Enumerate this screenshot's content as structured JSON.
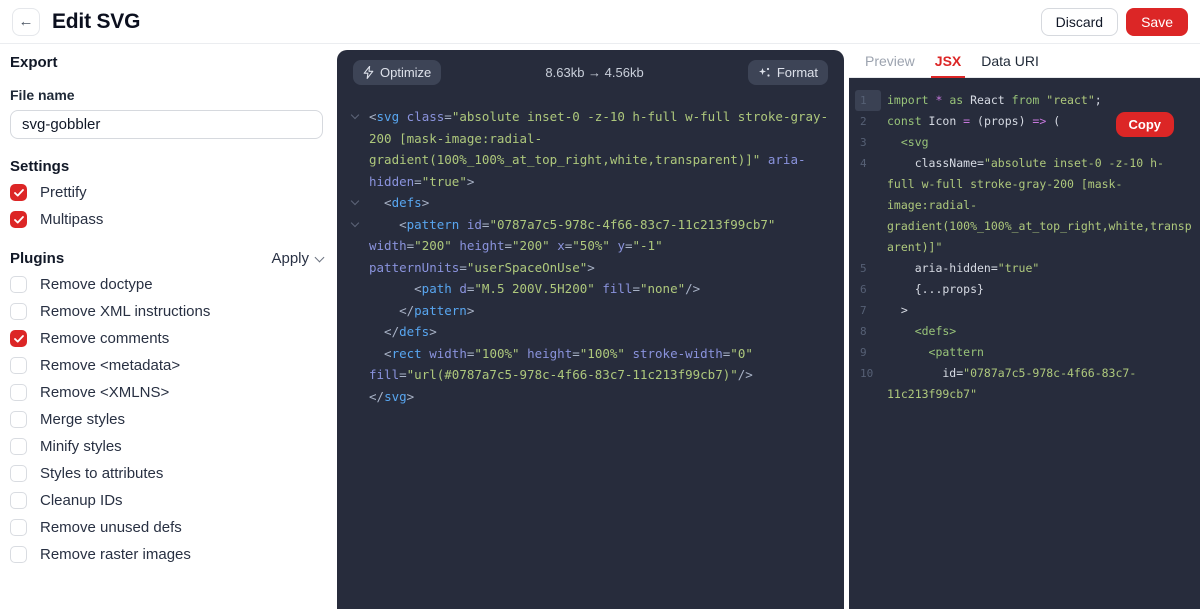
{
  "colors": {
    "accent_red": "#dc2626",
    "panel_bg": "#272c3c",
    "toolbar_button_bg": "#3d4456",
    "tag_blue": "#58a6f0",
    "attr_indigo": "#8a93dd",
    "value_green": "#aec87c",
    "keyword_green": "#98c379",
    "operator_purple": "#c678dd"
  },
  "header": {
    "title": "Edit SVG",
    "back_icon": "←",
    "discard_label": "Discard",
    "save_label": "Save"
  },
  "sidebar": {
    "export_heading": "Export",
    "file_name_label": "File name",
    "file_name_value": "svg-gobbler",
    "settings_heading": "Settings",
    "settings": [
      {
        "label": "Prettify",
        "checked": true
      },
      {
        "label": "Multipass",
        "checked": true
      }
    ],
    "plugins_heading": "Plugins",
    "apply_label": "Apply",
    "plugins": [
      {
        "label": "Remove doctype",
        "checked": false
      },
      {
        "label": "Remove XML instructions",
        "checked": false
      },
      {
        "label": "Remove comments",
        "checked": true
      },
      {
        "label": "Remove <metadata>",
        "checked": false
      },
      {
        "label": "Remove <XMLNS>",
        "checked": false
      },
      {
        "label": "Merge styles",
        "checked": false
      },
      {
        "label": "Minify styles",
        "checked": false
      },
      {
        "label": "Styles to attributes",
        "checked": false
      },
      {
        "label": "Cleanup IDs",
        "checked": false
      },
      {
        "label": "Remove unused defs",
        "checked": false
      },
      {
        "label": "Remove raster images",
        "checked": false
      }
    ]
  },
  "editor": {
    "optimize_label": "Optimize",
    "size_text": "8.63kb → 4.56kb",
    "format_label": "Format",
    "rows": [
      {
        "chev": true,
        "ind": 0,
        "segs": [
          [
            "p",
            "<"
          ],
          [
            "t",
            "svg"
          ],
          [
            "w",
            " "
          ],
          [
            "a",
            "class"
          ],
          [
            "p",
            "="
          ],
          [
            "s",
            "\"absolute inset-0 -z-10 h-full w-full stroke-gray-"
          ]
        ]
      },
      {
        "ind": 0,
        "segs": [
          [
            "s",
            "200 [mask-image:radial-"
          ]
        ]
      },
      {
        "ind": 0,
        "segs": [
          [
            "s",
            "gradient(100%_100%_at_top_right,white,transparent)]\""
          ],
          [
            "w",
            " "
          ],
          [
            "a",
            "aria-"
          ]
        ]
      },
      {
        "ind": 0,
        "segs": [
          [
            "a",
            "hidden"
          ],
          [
            "p",
            "="
          ],
          [
            "s",
            "\"true\""
          ],
          [
            "p",
            ">"
          ]
        ]
      },
      {
        "chev": true,
        "ind": 2,
        "segs": [
          [
            "p",
            "<"
          ],
          [
            "t",
            "defs"
          ],
          [
            "p",
            ">"
          ]
        ]
      },
      {
        "chev": true,
        "ind": 4,
        "segs": [
          [
            "p",
            "<"
          ],
          [
            "t",
            "pattern"
          ],
          [
            "w",
            " "
          ],
          [
            "a",
            "id"
          ],
          [
            "p",
            "="
          ],
          [
            "s",
            "\"0787a7c5-978c-4f66-83c7-11c213f99cb7\""
          ]
        ]
      },
      {
        "ind": 0,
        "segs": [
          [
            "a",
            "width"
          ],
          [
            "p",
            "="
          ],
          [
            "s",
            "\"200\""
          ],
          [
            "w",
            " "
          ],
          [
            "a",
            "height"
          ],
          [
            "p",
            "="
          ],
          [
            "s",
            "\"200\""
          ],
          [
            "w",
            " "
          ],
          [
            "a",
            "x"
          ],
          [
            "p",
            "="
          ],
          [
            "s",
            "\"50%\""
          ],
          [
            "w",
            " "
          ],
          [
            "a",
            "y"
          ],
          [
            "p",
            "="
          ],
          [
            "s",
            "\"-1\""
          ]
        ]
      },
      {
        "ind": 0,
        "segs": [
          [
            "a",
            "patternUnits"
          ],
          [
            "p",
            "="
          ],
          [
            "s",
            "\"userSpaceOnUse\""
          ],
          [
            "p",
            ">"
          ]
        ]
      },
      {
        "ind": 6,
        "segs": [
          [
            "p",
            "<"
          ],
          [
            "t",
            "path"
          ],
          [
            "w",
            " "
          ],
          [
            "a",
            "d"
          ],
          [
            "p",
            "="
          ],
          [
            "s",
            "\"M.5 200V.5H200\""
          ],
          [
            "w",
            " "
          ],
          [
            "a",
            "fill"
          ],
          [
            "p",
            "="
          ],
          [
            "s",
            "\"none\""
          ],
          [
            "p",
            "/>"
          ]
        ]
      },
      {
        "ind": 4,
        "segs": [
          [
            "p",
            "</"
          ],
          [
            "t",
            "pattern"
          ],
          [
            "p",
            ">"
          ]
        ]
      },
      {
        "ind": 2,
        "segs": [
          [
            "p",
            "</"
          ],
          [
            "t",
            "defs"
          ],
          [
            "p",
            ">"
          ]
        ]
      },
      {
        "ind": 2,
        "segs": [
          [
            "p",
            "<"
          ],
          [
            "t",
            "rect"
          ],
          [
            "w",
            " "
          ],
          [
            "a",
            "width"
          ],
          [
            "p",
            "="
          ],
          [
            "s",
            "\"100%\""
          ],
          [
            "w",
            " "
          ],
          [
            "a",
            "height"
          ],
          [
            "p",
            "="
          ],
          [
            "s",
            "\"100%\""
          ],
          [
            "w",
            " "
          ],
          [
            "a",
            "stroke-width"
          ],
          [
            "p",
            "="
          ],
          [
            "s",
            "\"0\""
          ]
        ]
      },
      {
        "ind": 0,
        "segs": [
          [
            "a",
            "fill"
          ],
          [
            "p",
            "="
          ],
          [
            "s",
            "\"url(#0787a7c5-978c-4f66-83c7-11c213f99cb7)\""
          ],
          [
            "p",
            "/>"
          ]
        ]
      },
      {
        "ind": 0,
        "segs": [
          [
            "p",
            "</"
          ],
          [
            "t",
            "svg"
          ],
          [
            "p",
            ">"
          ]
        ]
      }
    ]
  },
  "preview": {
    "tabs": [
      {
        "label": "Preview",
        "state": "muted"
      },
      {
        "label": "JSX",
        "state": "active"
      },
      {
        "label": "Data URI",
        "state": "normal"
      }
    ],
    "copy_label": "Copy",
    "rows": [
      {
        "num": "1",
        "hl": true,
        "ind": 0,
        "segs": [
          [
            "k",
            "import "
          ],
          [
            "o",
            "* "
          ],
          [
            "k",
            "as "
          ],
          [
            "w",
            "React "
          ],
          [
            "k",
            "from "
          ],
          [
            "s",
            "\"react\""
          ],
          [
            "w",
            ";"
          ]
        ]
      },
      {
        "num": "2",
        "ind": 0,
        "segs": [
          [
            "k",
            "const "
          ],
          [
            "w",
            "Icon "
          ],
          [
            "o",
            "= "
          ],
          [
            "w",
            "(props) "
          ],
          [
            "o",
            "=> "
          ],
          [
            "w",
            "("
          ]
        ]
      },
      {
        "num": "3",
        "ind": 2,
        "segs": [
          [
            "g",
            "<svg"
          ]
        ]
      },
      {
        "num": "4",
        "ind": 4,
        "segs": [
          [
            "w",
            "className="
          ],
          [
            "s",
            "\"absolute inset-0 -z-10 h-"
          ]
        ]
      },
      {
        "ind": 0,
        "segs": [
          [
            "s",
            "full w-full stroke-gray-200 [mask-"
          ]
        ]
      },
      {
        "ind": 0,
        "segs": [
          [
            "s",
            "image:radial-"
          ]
        ]
      },
      {
        "ind": 0,
        "segs": [
          [
            "s",
            "gradient(100%_100%_at_top_right,white,transp"
          ]
        ]
      },
      {
        "ind": 0,
        "segs": [
          [
            "s",
            "arent)]\""
          ]
        ]
      },
      {
        "num": "5",
        "ind": 4,
        "segs": [
          [
            "w",
            "aria-hidden="
          ],
          [
            "s",
            "\"true\""
          ]
        ]
      },
      {
        "num": "6",
        "ind": 4,
        "segs": [
          [
            "w",
            "{...props}"
          ]
        ]
      },
      {
        "num": "7",
        "ind": 2,
        "segs": [
          [
            "w",
            ">"
          ]
        ]
      },
      {
        "num": "8",
        "ind": 4,
        "segs": [
          [
            "g",
            "<defs>"
          ]
        ]
      },
      {
        "num": "9",
        "ind": 6,
        "segs": [
          [
            "g",
            "<pattern"
          ]
        ]
      },
      {
        "num": "10",
        "ind": 8,
        "segs": [
          [
            "w",
            "id="
          ],
          [
            "s",
            "\"0787a7c5-978c-4f66-83c7-"
          ]
        ]
      },
      {
        "ind": 0,
        "segs": [
          [
            "s",
            "11c213f99cb7\""
          ]
        ]
      }
    ]
  }
}
